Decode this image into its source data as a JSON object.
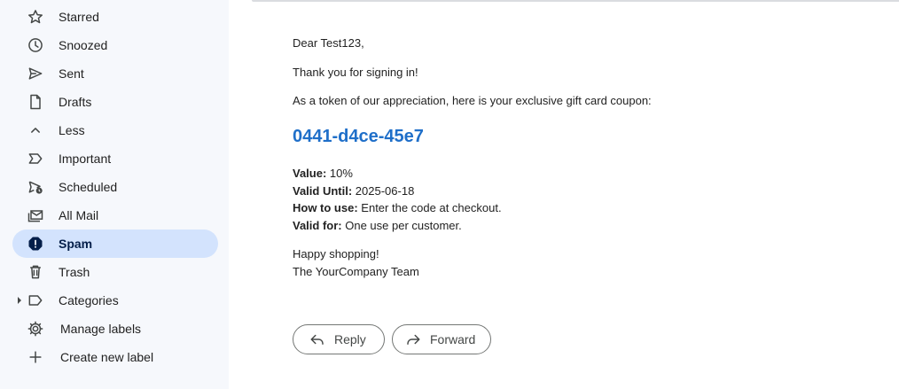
{
  "sidebar": {
    "items": [
      {
        "label": "Starred",
        "icon": "star-icon"
      },
      {
        "label": "Snoozed",
        "icon": "clock-icon"
      },
      {
        "label": "Sent",
        "icon": "send-icon"
      },
      {
        "label": "Drafts",
        "icon": "draft-icon"
      },
      {
        "label": "Less",
        "icon": "chevron-up-icon"
      },
      {
        "label": "Important",
        "icon": "important-icon"
      },
      {
        "label": "Scheduled",
        "icon": "scheduled-icon"
      },
      {
        "label": "All Mail",
        "icon": "all-mail-icon"
      },
      {
        "label": "Spam",
        "icon": "spam-icon",
        "active": true
      },
      {
        "label": "Trash",
        "icon": "trash-icon"
      },
      {
        "label": "Categories",
        "icon": "label-icon"
      },
      {
        "label": "Manage labels",
        "icon": "gear-icon"
      },
      {
        "label": "Create new label",
        "icon": "plus-icon"
      }
    ]
  },
  "email": {
    "greeting": "Dear Test123,",
    "thanks": "Thank you for signing in!",
    "token": "As a token of our appreciation, here is your exclusive gift card coupon:",
    "coupon_code": "0441-d4ce-45e7",
    "details": [
      {
        "key": "Value:",
        "value": "10%"
      },
      {
        "key": "Valid Until:",
        "value": "2025-06-18"
      },
      {
        "key": "How to use:",
        "value": "Enter the code at checkout."
      },
      {
        "key": "Valid for:",
        "value": "One use per customer."
      }
    ],
    "signoff_1": "Happy shopping!",
    "signoff_2": "The YourCompany Team"
  },
  "actions": {
    "reply_label": "Reply",
    "forward_label": "Forward"
  },
  "colors": {
    "active_bg": "#d3e3fd",
    "coupon": "#1f6fc9",
    "sidebar_bg": "#f6f8fc"
  }
}
